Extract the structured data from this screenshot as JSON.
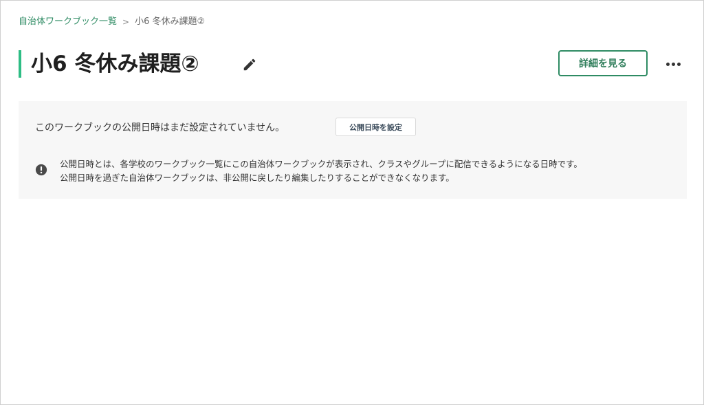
{
  "breadcrumb": {
    "parent": "自治体ワークブック一覧",
    "separator": ">",
    "current": "小6 冬休み課題②"
  },
  "header": {
    "title": "小6 冬休み課題②",
    "details_label": "詳細を見る",
    "edit_icon": "pencil-icon",
    "more_icon": "more-horizontal-icon"
  },
  "publish_panel": {
    "status_text": "このワークブックの公開日時はまだ設定されていません。",
    "set_date_label": "公開日時を設定",
    "info_icon": "exclamation-circle-icon",
    "info_line_1": "公開日時とは、各学校のワークブック一覧にこの自治体ワークブックが表示され、クラスやグループに配信できるようになる日時です。",
    "info_line_2": "公開日時を過ぎた自治体ワークブックは、非公開に戻したり編集したりすることができなくなります。"
  },
  "colors": {
    "accent_green": "#2e8b63",
    "title_bar": "#2ebd85",
    "panel_bg": "#f7f7f7"
  }
}
